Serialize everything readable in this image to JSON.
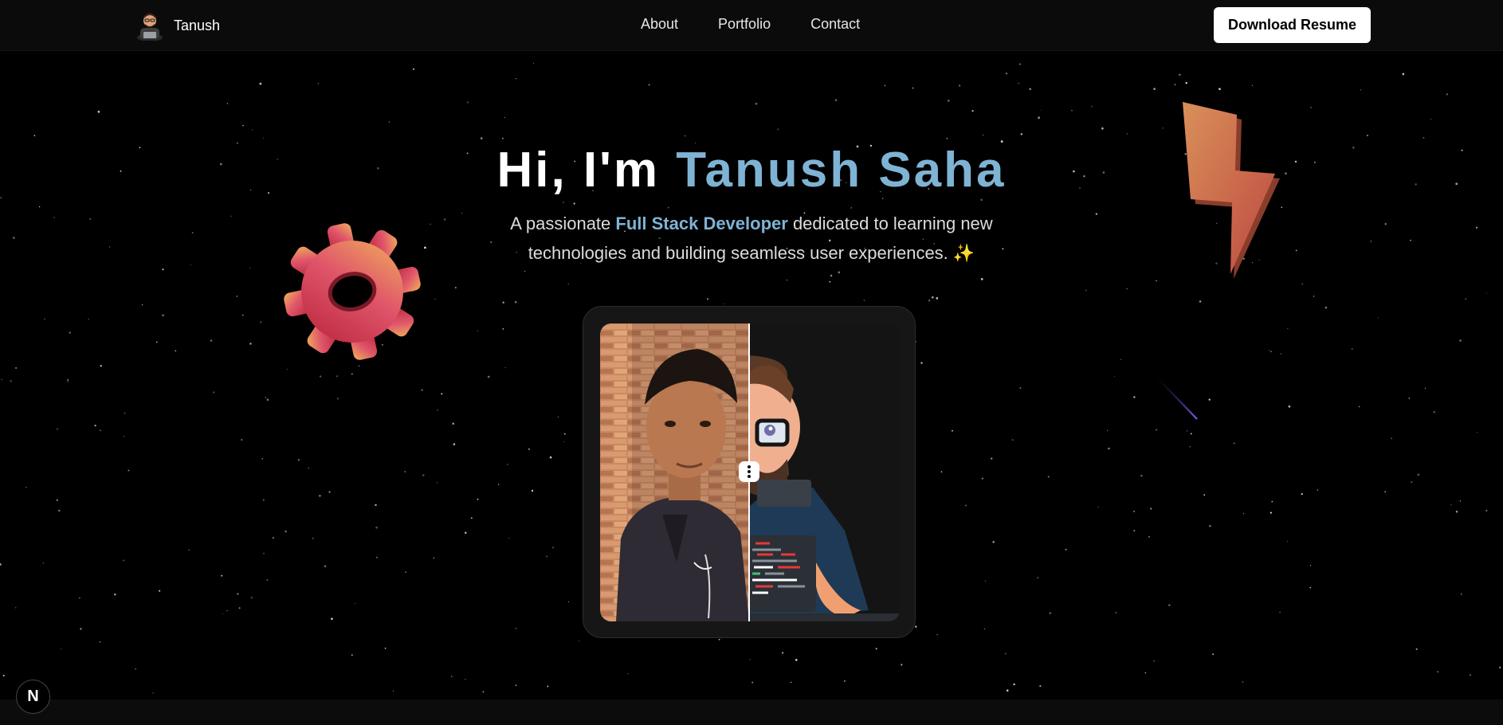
{
  "nav": {
    "brand_name": "Tanush",
    "links": [
      "About",
      "Portfolio",
      "Contact"
    ],
    "cta_label": "Download Resume"
  },
  "hero": {
    "greeting": "Hi, I'm ",
    "name": "Tanush Saha",
    "subtitle_pre": "A passionate ",
    "subtitle_role": "Full Stack Developer",
    "subtitle_post": " dedicated to learning new technologies and building seamless user experiences. ",
    "sparkle": "✨"
  },
  "card": {
    "comparison": {
      "left": "photo",
      "right": "cartoon-avatar",
      "slider_handle_icon": "vertical-dots-icon"
    }
  },
  "framework_badge": {
    "letter": "N",
    "icon": "nextjs-icon"
  },
  "colors": {
    "background": "#000000",
    "nav_bg": "#0b0b0b",
    "accent": "#7fb3d4",
    "card_bg": "#161616"
  }
}
